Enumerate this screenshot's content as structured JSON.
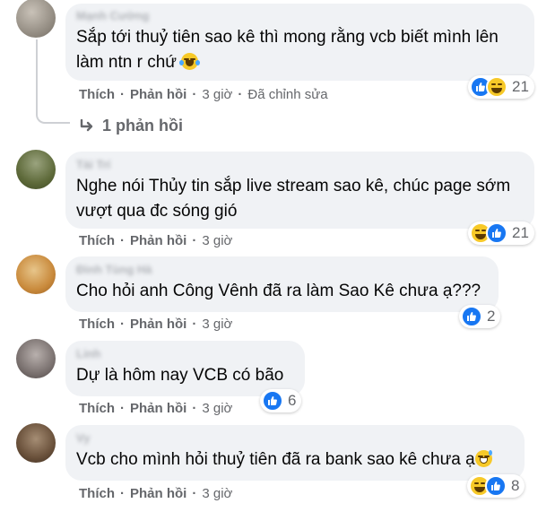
{
  "action_labels": {
    "like": "Thích",
    "reply": "Phản hồi"
  },
  "separator": "·",
  "colors": {
    "bubble_bg": "#f0f2f5",
    "secondary_text": "#65676b",
    "like_blue": "#1877f2",
    "haha_yellow": "#f7c928"
  },
  "comments": [
    {
      "author": "Mạnh Cường",
      "text": "Sắp tới thuỷ tiên sao kê thì mong rằng vcb biết mình lên làm ntn r chứ",
      "trailing_emoji": "tears-of-joy-emoji",
      "time": "3 giờ",
      "edited": "Đã chỉnh sửa",
      "reactions": [
        "like",
        "haha"
      ],
      "reaction_count": "21",
      "replies_label": "1 phản hồi"
    },
    {
      "author": "Tài Trí",
      "text": "Nghe nói Thủy tin sắp live stream sao kê, chúc page sớm vượt qua đc sóng gió",
      "time": "3 giờ",
      "reactions": [
        "haha",
        "like"
      ],
      "reaction_count": "21"
    },
    {
      "author": "Đình Tùng Hà",
      "text": "Cho hỏi anh Công Vênh đã ra làm Sao Kê chưa ạ???",
      "time": "3 giờ",
      "reactions": [
        "like"
      ],
      "reaction_count": "2"
    },
    {
      "author": "Linh",
      "text": "Dự là hôm nay VCB có bão",
      "time": "3 giờ",
      "reactions": [
        "like"
      ],
      "reaction_count": "6"
    },
    {
      "author": "Vy",
      "text": "Vcb cho mình hỏi thuỷ tiên đã ra bank sao kê chưa ạ",
      "trailing_emoji": "grinning-sweat-emoji",
      "time": "3 giờ",
      "reactions": [
        "haha",
        "like"
      ],
      "reaction_count": "8"
    }
  ]
}
